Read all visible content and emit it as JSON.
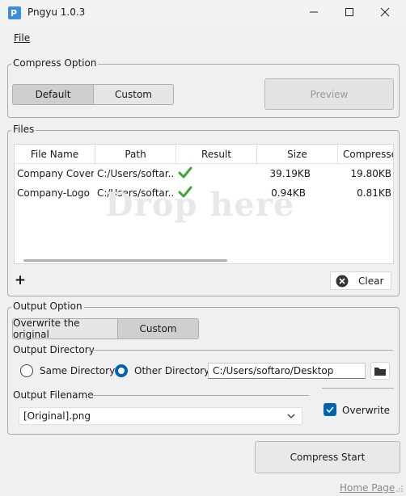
{
  "window": {
    "title": "Pngyu 1.0.3"
  },
  "menu": {
    "file_label": "File"
  },
  "compress_option": {
    "legend": "Compress Option",
    "modes": [
      "Default",
      "Custom"
    ],
    "selected_mode": "Default",
    "preview_label": "Preview"
  },
  "files": {
    "legend": "Files",
    "columns": [
      "File Name",
      "Path",
      "Result",
      "Size",
      "Compressed"
    ],
    "rows": [
      {
        "name": "Company Cover...",
        "path": "C:/Users/softar...",
        "result": "ok",
        "size": "39.19KB",
        "compressed": "19.80KB"
      },
      {
        "name": "Company-Logo",
        "path": "C:/Users/softar...",
        "result": "ok",
        "size": "0.94KB",
        "compressed": "0.81KB"
      }
    ],
    "drop_hint": "Drop here",
    "add_label": "+",
    "clear_label": "Clear"
  },
  "output_option": {
    "legend": "Output Option",
    "modes": [
      "Overwrite the original",
      "Custom"
    ],
    "selected_mode": "Custom",
    "directory_label": "Output Directory",
    "same_dir_label": "Same Directory",
    "other_dir_label": "Other Directory",
    "directory_value": "C:/Users/softaro/Desktop",
    "filename_label": "Output Filename",
    "filename_value": "[Original].png",
    "overwrite_label": "Overwrite",
    "overwrite_checked": true
  },
  "compress_start_label": "Compress Start",
  "home_page_label": "Home Page",
  "colors": {
    "accent": "#0063b1",
    "check_green": "#3da83a"
  }
}
